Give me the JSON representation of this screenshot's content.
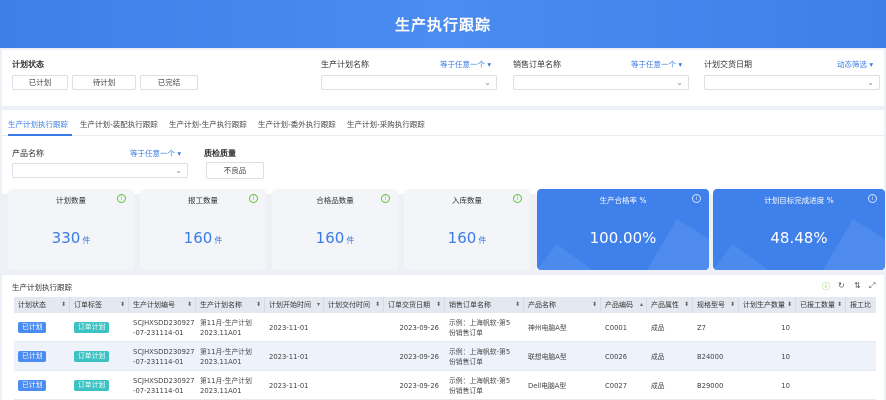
{
  "header": {
    "title": "生产执行跟踪"
  },
  "filters": {
    "plan_status_label": "计划状态",
    "plan_status_options": [
      "已计划",
      "待计划",
      "已完结"
    ],
    "plan_name_label": "生产计划名称",
    "plan_name_operator": "等于任意一个 ▾",
    "sales_order_label": "销售订单名称",
    "sales_order_operator": "等于任意一个 ▾",
    "delivery_date_label": "计划交货日期",
    "delivery_date_operator": "动态筛选 ▾"
  },
  "tabs": [
    "生产计划执行跟踪",
    "生产计划-装配执行跟踪",
    "生产计划-生产执行跟踪",
    "生产计划-委外执行跟踪",
    "生产计划-采购执行跟踪"
  ],
  "subfilters": {
    "product_label": "产品名称",
    "product_operator": "等于任意一个 ▾",
    "quality_label": "质检质量",
    "quality_option": "不良品"
  },
  "metrics": [
    {
      "label": "计划数量",
      "value": "330",
      "unit": "件"
    },
    {
      "label": "报工数量",
      "value": "160",
      "unit": "件"
    },
    {
      "label": "合格品数量",
      "value": "160",
      "unit": "件"
    },
    {
      "label": "入库数量",
      "value": "160",
      "unit": "件"
    },
    {
      "label": "生产合格率 %",
      "value": "100.00%",
      "unit": ""
    },
    {
      "label": "计划目标完成进度 %",
      "value": "48.48%",
      "unit": ""
    }
  ],
  "table": {
    "title": "生产计划执行跟踪",
    "columns": [
      "计划状态",
      "订单标签",
      "生产计划编号",
      "生产计划名称",
      "计划开始时间",
      "计划交付时间",
      "订单交货日期",
      "销售订单名称",
      "产品名称",
      "产品编码",
      "产品属性",
      "规格型号",
      "计划生产数量",
      "已报工数量",
      "报工比"
    ],
    "rows": [
      {
        "status": "已计划",
        "tag": "订单计划",
        "code1": "SCJHXSDD230927",
        "code2": "-07-231114-01",
        "name1": "第11月-生产计划",
        "name2": "2023.11A01",
        "start": "2023-11-01",
        "deliver": "",
        "due": "2023-09-26",
        "order1": "示例：上海帆软-第5",
        "order2": "份销售订单",
        "product": "神州电脑A型",
        "pcode": "C0001",
        "attr": "成品",
        "spec": "Z7",
        "qty": "10",
        "done": "",
        "ratio": ""
      },
      {
        "status": "已计划",
        "tag": "订单计划",
        "code1": "SCJHXSDD230927",
        "code2": "-07-231114-01",
        "name1": "第11月-生产计划",
        "name2": "2023.11A01",
        "start": "2023-11-01",
        "deliver": "",
        "due": "2023-09-26",
        "order1": "示例：上海帆软-第5",
        "order2": "份销售订单",
        "product": "联想电脑A型",
        "pcode": "C0026",
        "attr": "成品",
        "spec": "B24000",
        "qty": "10",
        "done": "",
        "ratio": ""
      },
      {
        "status": "已计划",
        "tag": "订单计划",
        "code1": "SCJHXSDD230927",
        "code2": "-07-231114-01",
        "name1": "第11月-生产计划",
        "name2": "2023.11A01",
        "start": "2023-11-01",
        "deliver": "",
        "due": "2023-09-26",
        "order1": "示例：上海帆软-第5",
        "order2": "份销售订单",
        "product": "Dell电脑A型",
        "pcode": "C0027",
        "attr": "成品",
        "spec": "B29000",
        "qty": "10",
        "done": "",
        "ratio": ""
      }
    ]
  },
  "colors": {
    "accent": "#3f80ea",
    "tag_blue": "#4a8cf0",
    "tag_teal": "#3cc2c2",
    "info_green": "#67c23a"
  },
  "icons": [
    "chevron-down-icon",
    "info-icon",
    "refresh-icon",
    "filter-icon",
    "fullscreen-icon",
    "sort-icon"
  ]
}
